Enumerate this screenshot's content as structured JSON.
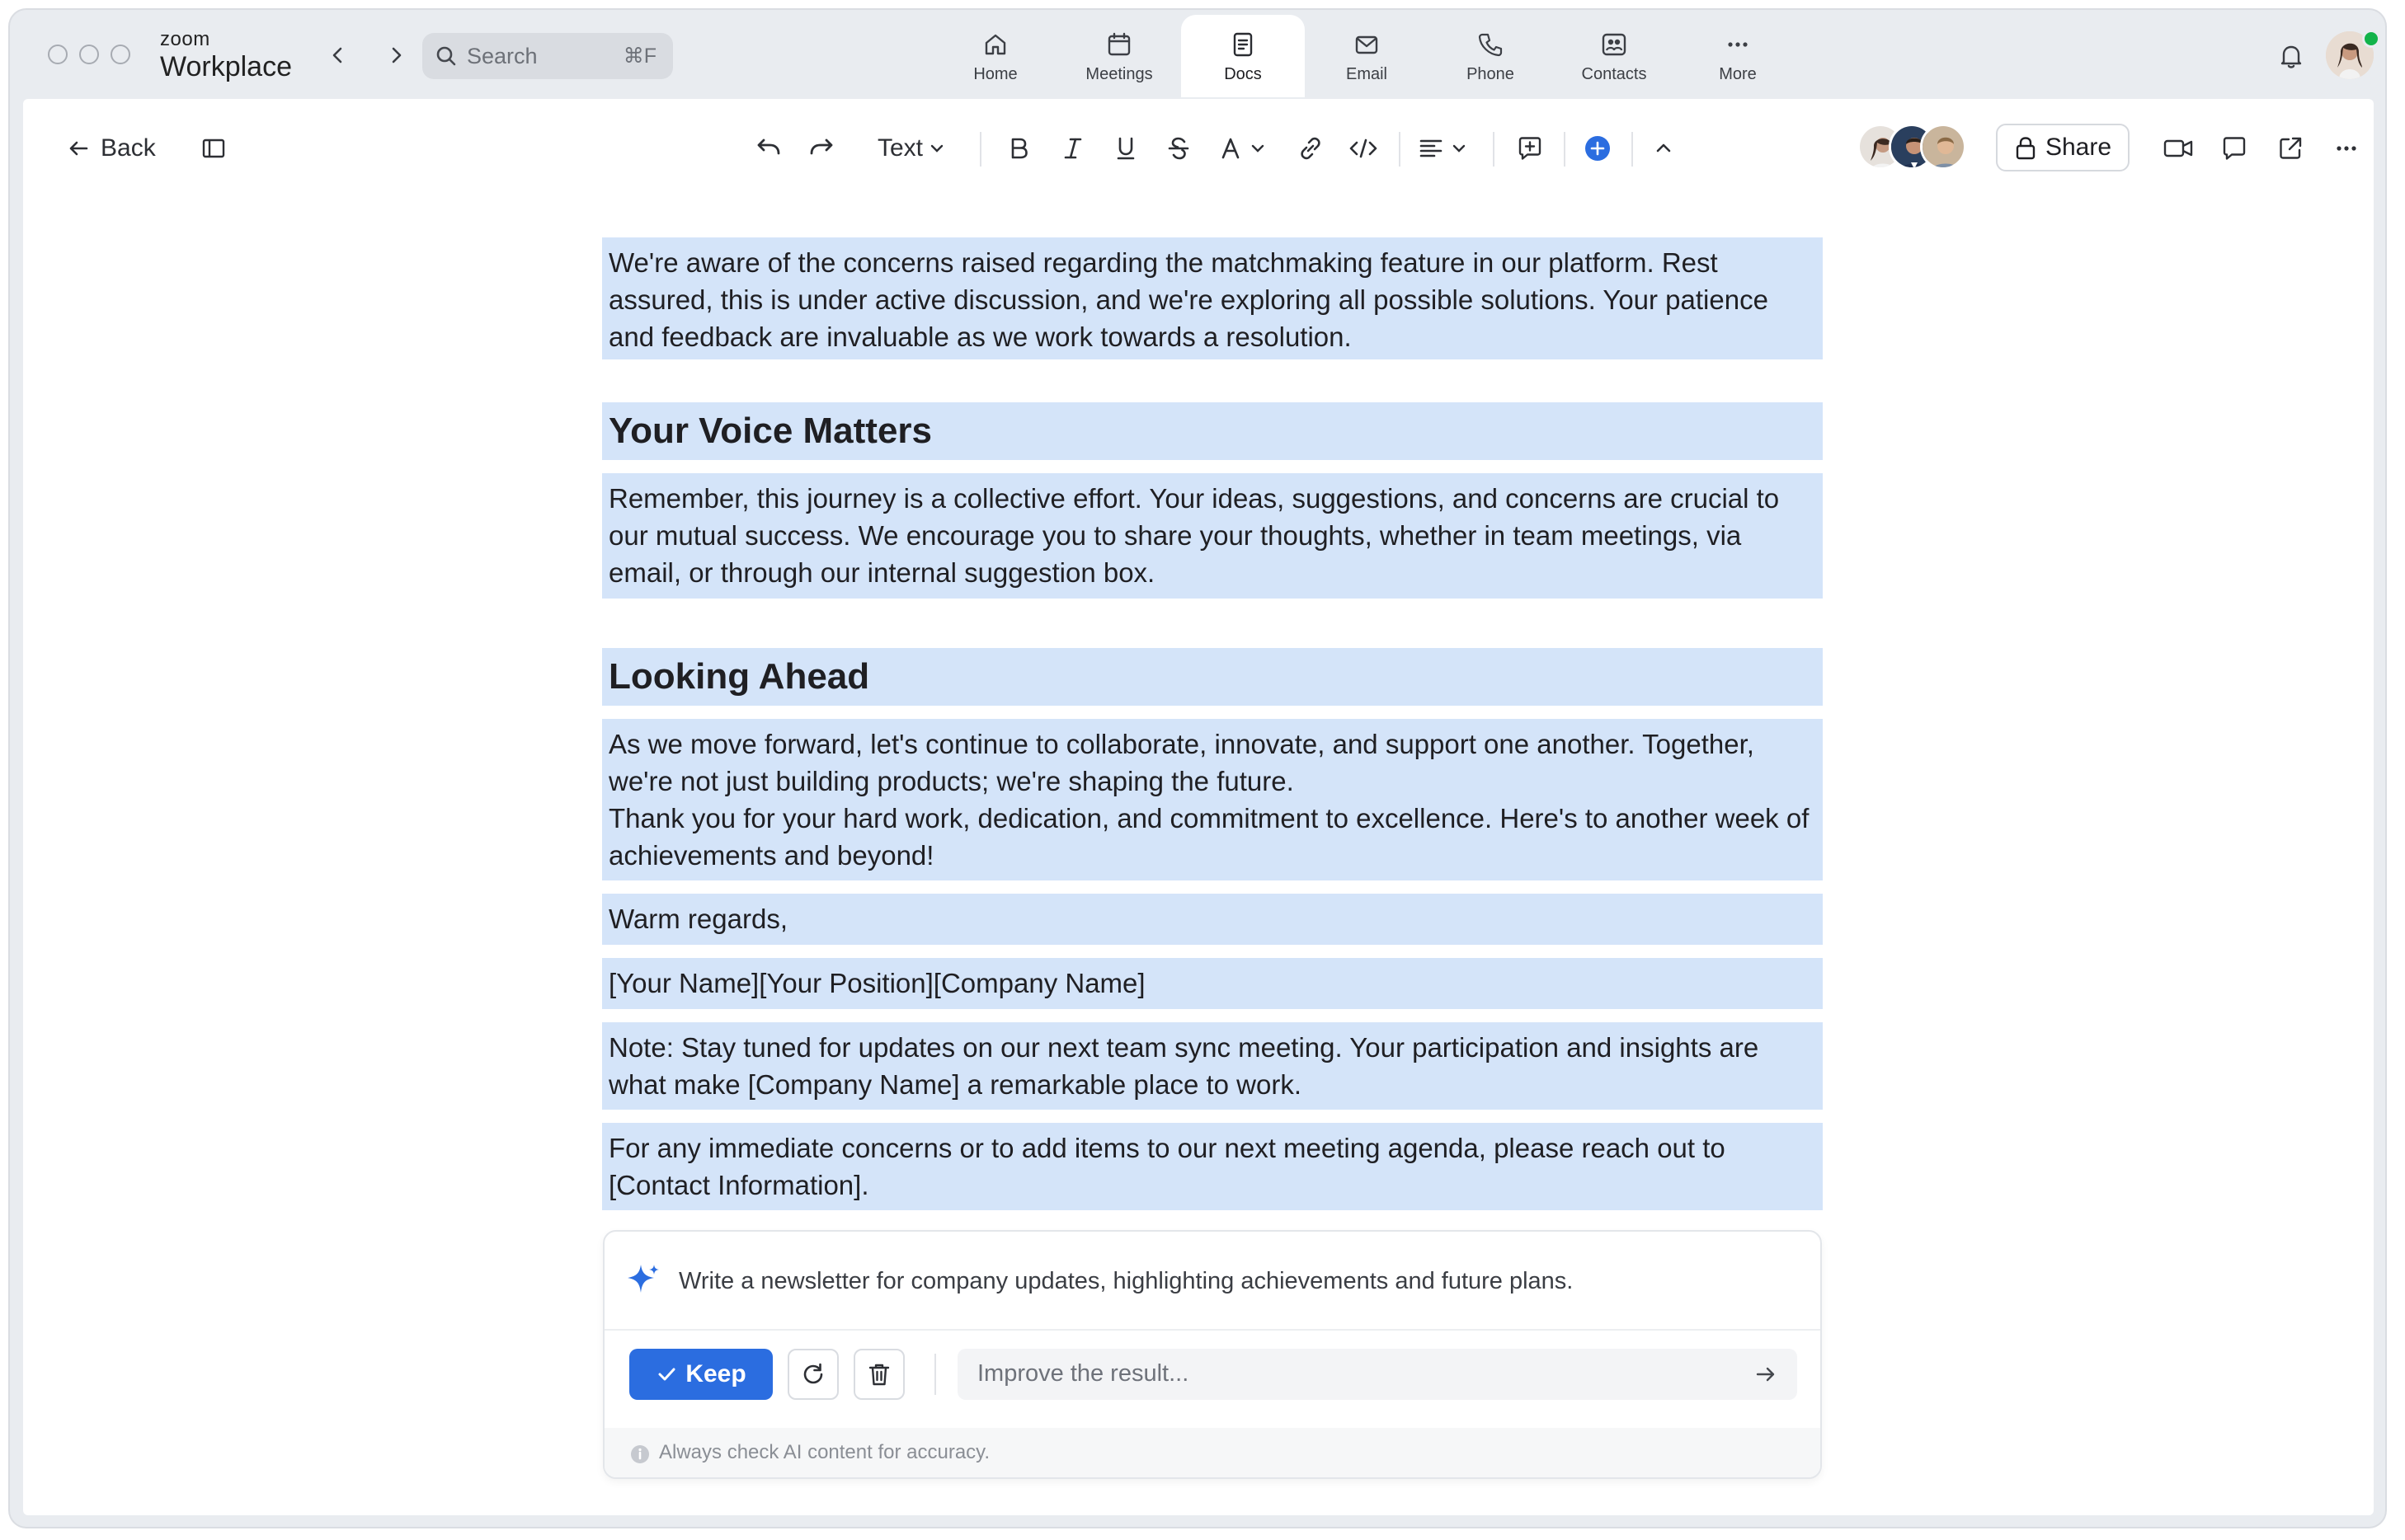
{
  "app": {
    "brand_small": "zoom",
    "brand_big": "Workplace",
    "search_placeholder": "Search",
    "search_shortcut": "⌘F"
  },
  "tabs": [
    {
      "label": "Home",
      "icon": "home-icon"
    },
    {
      "label": "Meetings",
      "icon": "calendar-icon"
    },
    {
      "label": "Docs",
      "icon": "document-icon",
      "active": true
    },
    {
      "label": "Email",
      "icon": "mail-icon"
    },
    {
      "label": "Phone",
      "icon": "phone-icon"
    },
    {
      "label": "Contacts",
      "icon": "contacts-icon"
    },
    {
      "label": "More",
      "icon": "more-icon"
    }
  ],
  "toolbar": {
    "back_label": "Back",
    "text_style": "Text",
    "share_label": "Share"
  },
  "document": {
    "blocks": [
      {
        "type": "p",
        "text": "We're aware of the concerns raised regarding the matchmaking feature in our platform. Rest assured, this is under active discussion, and we're exploring all possible solutions. Your patience and feedback are invaluable as we work towards a resolution."
      },
      {
        "type": "h",
        "text": "Your Voice Matters"
      },
      {
        "type": "p",
        "text": "Remember, this journey is a collective effort. Your ideas, suggestions, and concerns are crucial to our mutual success. We encourage you to share your thoughts, whether in team meetings, via email, or through our internal suggestion box."
      },
      {
        "type": "h",
        "text": "Looking Ahead"
      },
      {
        "type": "p",
        "text": "As we move forward, let's continue to collaborate, innovate, and support one another. Together, we're not just building products; we're shaping the future.\nThank you for your hard work, dedication, and commitment to excellence. Here's to another week of achievements and beyond!"
      },
      {
        "type": "p",
        "text": "Warm regards,"
      },
      {
        "type": "p",
        "text": "[Your Name][Your Position][Company Name]"
      },
      {
        "type": "p",
        "text": "Note: Stay tuned for updates on our next team sync meeting. Your participation and insights are what make [Company Name] a remarkable place to work."
      },
      {
        "type": "p",
        "text": "For any immediate concerns or to add items to our next meeting agenda, please reach out to [Contact Information]."
      }
    ]
  },
  "ai_panel": {
    "prompt": "Write a newsletter for company updates, highlighting achievements and future plans.",
    "keep_label": "Keep",
    "improve_placeholder": "Improve the result...",
    "disclaimer": "Always check AI content for accuracy."
  },
  "colors": {
    "highlight": "#d4e4f9",
    "accent": "#2b6de0",
    "online": "#12b34a"
  }
}
